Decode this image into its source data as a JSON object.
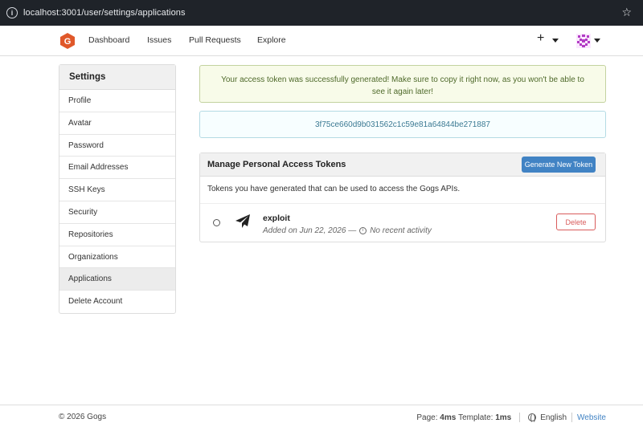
{
  "browser": {
    "url": "localhost:3001/user/settings/applications"
  },
  "nav": {
    "items": [
      "Dashboard",
      "Issues",
      "Pull Requests",
      "Explore"
    ],
    "plus": "+"
  },
  "sidebar": {
    "title": "Settings",
    "items": [
      {
        "label": "Profile"
      },
      {
        "label": "Avatar"
      },
      {
        "label": "Password"
      },
      {
        "label": "Email Addresses"
      },
      {
        "label": "SSH Keys"
      },
      {
        "label": "Security"
      },
      {
        "label": "Repositories"
      },
      {
        "label": "Organizations"
      },
      {
        "label": "Applications",
        "active": true
      },
      {
        "label": "Delete Account"
      }
    ]
  },
  "alert": {
    "message": "Your access token was successfully generated! Make sure to copy it right now, as you won't be able to see it again later!"
  },
  "token_value": "3f75ce660d9b031562c1c59e81a64844be271887",
  "panel": {
    "title": "Manage Personal Access Tokens",
    "generate_label": "Generate New Token",
    "description": "Tokens you have generated that can be used to access the Gogs APIs.",
    "tokens": [
      {
        "name": "exploit",
        "added": "Added on Jun 22, 2026 —",
        "activity": "No recent activity",
        "delete_label": "Delete"
      }
    ]
  },
  "footer": {
    "copyright": "© 2026 Gogs",
    "page_label": "Page:",
    "page_time": "4ms",
    "template_label": "Template:",
    "template_time": "1ms",
    "language": "English",
    "website": "Website"
  },
  "colors": {
    "accent": "#4183c4",
    "success_bg": "#f8fbe9",
    "danger": "#d95c5c",
    "logo": "#e0582a"
  },
  "icons": {
    "logo": "gogs-logo",
    "token": "paper-plane-icon",
    "star": "star-icon",
    "info": "info-icon"
  }
}
